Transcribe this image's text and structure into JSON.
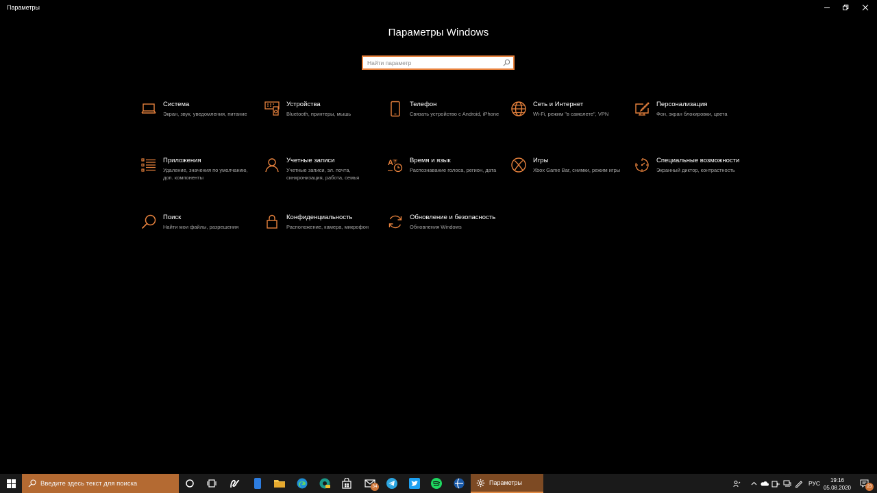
{
  "window": {
    "title": "Параметры"
  },
  "header": {
    "title": "Параметры Windows"
  },
  "search": {
    "placeholder": "Найти параметр"
  },
  "accent": "#e8823d",
  "categories": [
    {
      "name": "Система",
      "desc": "Экран, звук, уведомления, питание",
      "icon": "laptop-icon"
    },
    {
      "name": "Устройства",
      "desc": "Bluetooth, принтеры, мышь",
      "icon": "keyboard-speaker-icon"
    },
    {
      "name": "Телефон",
      "desc": "Связать устройство с Android, iPhone",
      "icon": "phone-icon"
    },
    {
      "name": "Сеть и Интернет",
      "desc": "Wi-Fi, режим \"в самолете\", VPN",
      "icon": "globe-icon"
    },
    {
      "name": "Персонализация",
      "desc": "Фон, экран блокировки, цвета",
      "icon": "brush-monitor-icon"
    },
    {
      "name": "Приложения",
      "desc": "Удаление, значения по умолчанию, доп. компоненты",
      "icon": "apps-list-icon"
    },
    {
      "name": "Учетные записи",
      "desc": "Учетные записи, эл. почта, синхронизация, работа, семья",
      "icon": "person-icon"
    },
    {
      "name": "Время и язык",
      "desc": "Распознавание голоса, регион, дата",
      "icon": "time-language-icon"
    },
    {
      "name": "Игры",
      "desc": "Xbox Game Bar, снимки, режим игры",
      "icon": "xbox-icon"
    },
    {
      "name": "Специальные возможности",
      "desc": "Экранный диктор, контрастность",
      "icon": "accessibility-icon"
    },
    {
      "name": "Поиск",
      "desc": "Найти мои файлы, разрешения",
      "icon": "search-icon"
    },
    {
      "name": "Конфиденциальность",
      "desc": "Расположение, камера, микрофон",
      "icon": "lock-icon"
    },
    {
      "name": "Обновление и безопасность",
      "desc": "Обновления Windows",
      "icon": "sync-icon"
    }
  ],
  "taskbar": {
    "search_placeholder": "Введите здесь текст для поиска",
    "active_app": "Параметры",
    "mail_badge": "34",
    "language": "РУС",
    "time": "19:16",
    "date": "05.08.2020",
    "notifications_badge": "23"
  }
}
